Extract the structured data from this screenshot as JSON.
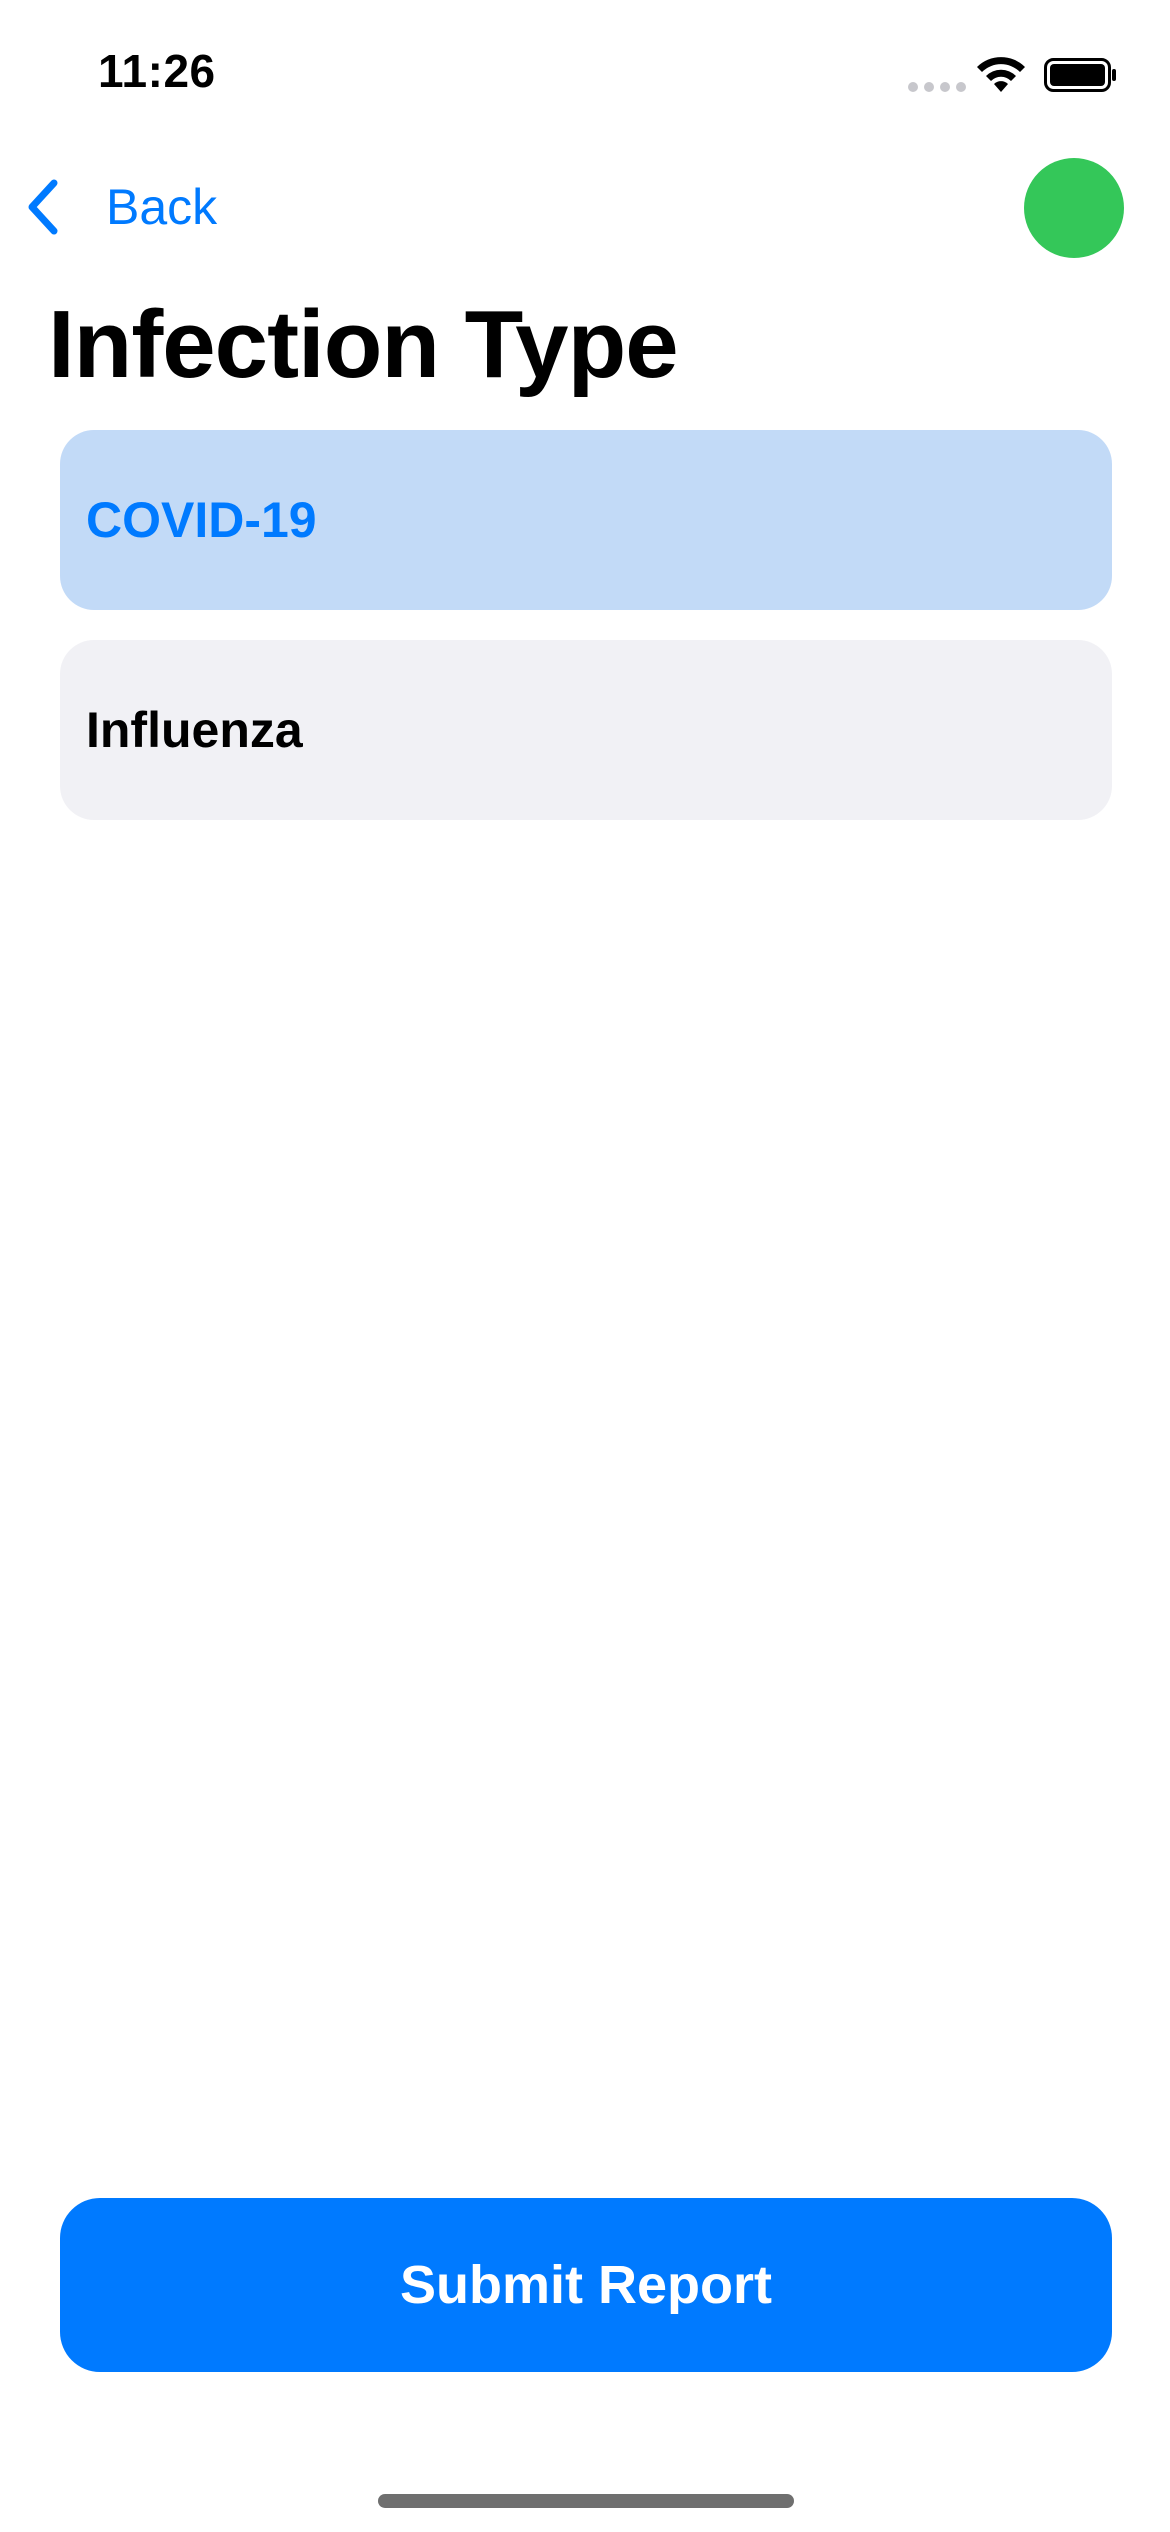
{
  "status_bar": {
    "time": "11:26"
  },
  "nav": {
    "back_label": "Back",
    "status_color": "#34c759"
  },
  "page": {
    "title": "Infection Type"
  },
  "options": [
    {
      "label": "COVID-19",
      "selected": true
    },
    {
      "label": "Influenza",
      "selected": false
    }
  ],
  "actions": {
    "submit_label": "Submit Report"
  },
  "colors": {
    "accent": "#007aff",
    "selected_background": "#c2daf7",
    "unselected_background": "#f1f1f5",
    "status_dot": "#34c759"
  },
  "icons": {
    "back": "chevron-left-icon",
    "wifi": "wifi-icon",
    "battery": "battery-icon",
    "signal": "cellular-signal-icon"
  }
}
